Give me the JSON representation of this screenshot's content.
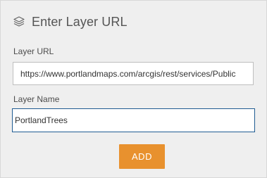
{
  "header": {
    "title": "Enter Layer URL",
    "icon": "layers-icon"
  },
  "form": {
    "url_label": "Layer URL",
    "url_value": "https://www.portlandmaps.com/arcgis/rest/services/Public",
    "name_label": "Layer Name",
    "name_value": "PortlandTrees",
    "add_label": "ADD"
  },
  "colors": {
    "panel_bg": "#efefef",
    "accent_button": "#e8912e",
    "focus_border": "#1f5b92"
  }
}
